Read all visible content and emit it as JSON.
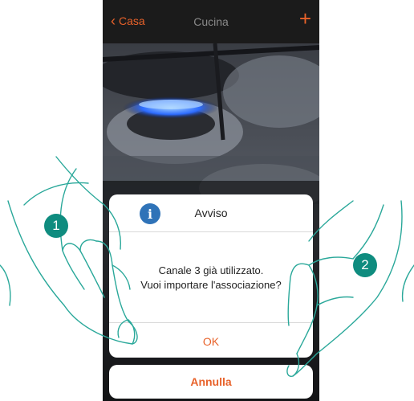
{
  "navbar": {
    "back_label": "Casa",
    "title": "Cucina",
    "add_symbol": "+"
  },
  "dialog": {
    "title": "Avviso",
    "message_line1": "Canale 3 già utilizzato.",
    "message_line2": "Vuoi importare l'associazione?",
    "ok_label": "OK",
    "info_symbol": "i"
  },
  "cancel_label": "Annulla",
  "steps": [
    "1",
    "2"
  ],
  "colors": {
    "accent": "#e8622a",
    "info": "#2f73b8",
    "step_badge": "#0f8c7f"
  },
  "icons": [
    "chevron-left-icon",
    "plus-icon",
    "info-icon",
    "hand-pointer-icon"
  ]
}
